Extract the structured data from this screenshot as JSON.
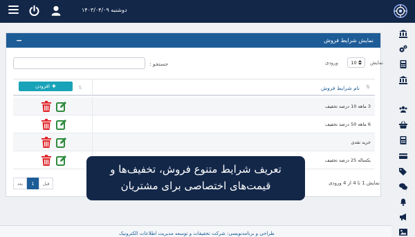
{
  "topbar": {
    "date": "دوشنبه ۱۴۰۳/۰۴/۰۹",
    "icons": [
      "menu-icon",
      "power-icon",
      "user-icon",
      "logo-icon"
    ]
  },
  "sidebar": {
    "icons": [
      "bank-icon",
      "cogs-icon",
      "calculator-icon",
      "bank-icon",
      "users-icon",
      "basket-icon",
      "calculator-icon",
      "credit-card-icon",
      "tags-icon",
      "comments-icon",
      "bell-icon",
      "bullhorn-icon",
      "image-icon"
    ]
  },
  "panel": {
    "title": "نمایش شرایط فروش",
    "collapse_symbol": "−"
  },
  "controls": {
    "length_label_before": "نمایش",
    "length_value": "10",
    "length_label_after": "ورودی",
    "search_label": "جستجو :",
    "search_value": ""
  },
  "table": {
    "name_header": "نام شرایط فروش",
    "add_button": "افزودن",
    "rows": [
      {
        "name": "3 ماهه 10 درصد تخفیف"
      },
      {
        "name": "6 ماهه 50 درصد تخفیف"
      },
      {
        "name": "خرید نقدی"
      },
      {
        "name": "یکساله 25 درصد تخفیف"
      }
    ],
    "colors": {
      "delete": "#e0262b",
      "edit": "#2e8b3e",
      "accent": "#1d5c97",
      "add": "#19a3b8"
    }
  },
  "footer_info": {
    "info": "نمایش 1 تا 4 از 4 ورودی",
    "prev": "قبل",
    "page": "1",
    "next": "بعد"
  },
  "footer": {
    "text": "طراحی و برنامه‌نویسی: شرکت تحقیقات و توسعه مدیریت اطلاعات الکترونیک"
  },
  "caption": {
    "line1": "تعریف شرایط متنوع فروش، تخفیف‌ها و",
    "line2": "قیمت‌های اختصاصی برای مشتریان"
  }
}
